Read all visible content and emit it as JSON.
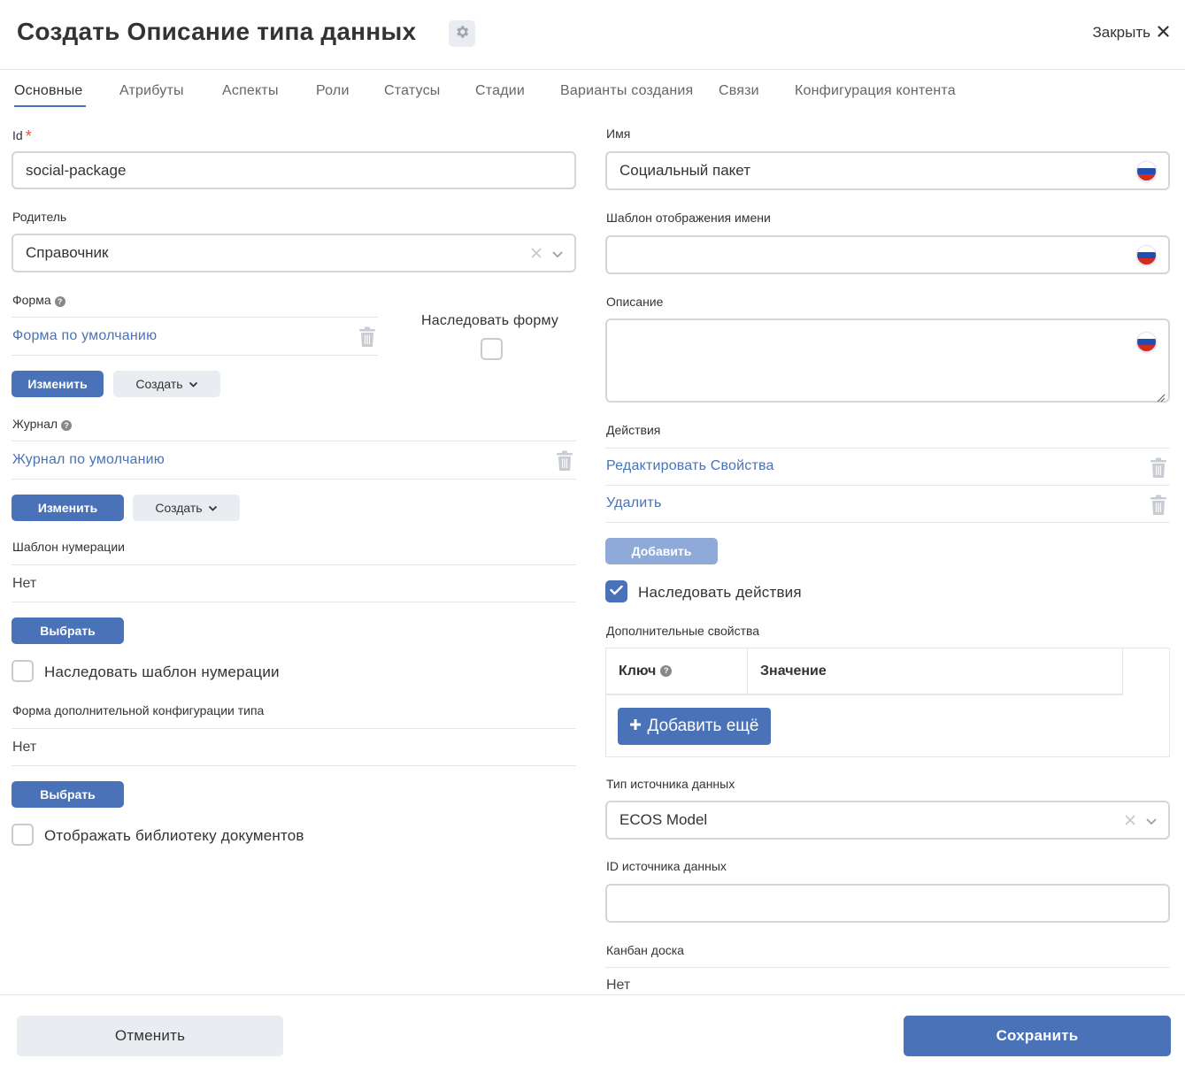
{
  "header": {
    "title": "Создать Описание типа данных",
    "close_label": "Закрыть"
  },
  "tabs": [
    {
      "label": "Основные",
      "active": true
    },
    {
      "label": "Атрибуты"
    },
    {
      "label": "Аспекты"
    },
    {
      "label": "Роли"
    },
    {
      "label": "Статусы"
    },
    {
      "label": "Стадии"
    },
    {
      "label": "Варианты создания"
    },
    {
      "label": "Связи"
    },
    {
      "label": "Конфигурация контента"
    }
  ],
  "left": {
    "id": {
      "label": "Id",
      "value": "social-package"
    },
    "parent": {
      "label": "Родитель",
      "value": "Справочник"
    },
    "form": {
      "label": "Форма",
      "value": "Форма по умолчанию",
      "change_label": "Изменить",
      "create_label": "Создать",
      "inherit_label": "Наследовать форму",
      "inherit_checked": false
    },
    "journal": {
      "label": "Журнал",
      "value": "Журнал по умолчанию",
      "change_label": "Изменить",
      "create_label": "Создать"
    },
    "numbering": {
      "label": "Шаблон нумерации",
      "value": "Нет",
      "select_label": "Выбрать",
      "inherit_label": "Наследовать шаблон нумерации",
      "inherit_checked": false
    },
    "config_form": {
      "label": "Форма дополнительной конфигурации типа",
      "value": "Нет",
      "select_label": "Выбрать"
    },
    "show_doc_lib": {
      "label": "Отображать библиотеку документов",
      "checked": false
    }
  },
  "right": {
    "name": {
      "label": "Имя",
      "value": "Социальный пакет"
    },
    "name_template": {
      "label": "Шаблон отображения имени",
      "value": ""
    },
    "description": {
      "label": "Описание",
      "value": ""
    },
    "actions": {
      "label": "Действия",
      "items": [
        "Редактировать Свойства",
        "Удалить"
      ],
      "add_label": "Добавить",
      "inherit_label": "Наследовать действия",
      "inherit_checked": true
    },
    "properties": {
      "label": "Дополнительные свойства",
      "col_key": "Ключ",
      "col_value": "Значение",
      "add_more_label": "Добавить ещё"
    },
    "source_type": {
      "label": "Тип источника данных",
      "value": "ECOS Model"
    },
    "source_id": {
      "label": "ID источника данных",
      "value": ""
    },
    "kanban": {
      "label": "Канбан доска",
      "value": "Нет"
    }
  },
  "footer": {
    "cancel_label": "Отменить",
    "save_label": "Сохранить"
  },
  "colors": {
    "accent": "#4a72b8",
    "accent_disabled": "#8fa9d9",
    "required": "#f0522e",
    "link": "#4a72b8"
  }
}
